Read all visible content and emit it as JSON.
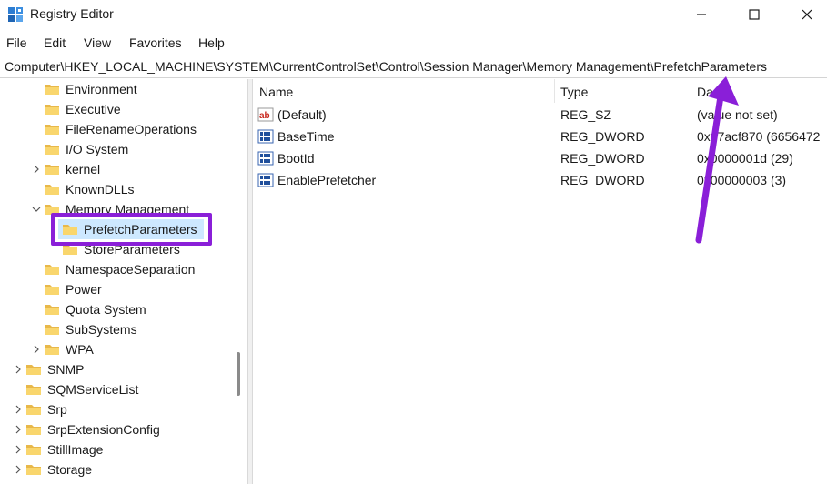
{
  "window": {
    "title": "Registry Editor",
    "controls": [
      "minimize",
      "maximize",
      "close"
    ]
  },
  "menu": {
    "items": [
      "File",
      "Edit",
      "View",
      "Favorites",
      "Help"
    ]
  },
  "address": {
    "path": "Computer\\HKEY_LOCAL_MACHINE\\SYSTEM\\CurrentControlSet\\Control\\Session Manager\\Memory Management\\PrefetchParameters"
  },
  "tree": {
    "items": [
      {
        "label": "Environment",
        "chevron": "none"
      },
      {
        "label": "Executive",
        "chevron": "none"
      },
      {
        "label": "FileRenameOperations",
        "chevron": "none"
      },
      {
        "label": "I/O System",
        "chevron": "none"
      },
      {
        "label": "kernel",
        "chevron": "collapsed"
      },
      {
        "label": "KnownDLLs",
        "chevron": "none"
      },
      {
        "label": "Memory Management",
        "chevron": "expanded"
      },
      {
        "label": "PrefetchParameters",
        "chevron": "none",
        "selected": true
      },
      {
        "label": "StoreParameters",
        "chevron": "none"
      },
      {
        "label": "NamespaceSeparation",
        "chevron": "none"
      },
      {
        "label": "Power",
        "chevron": "none"
      },
      {
        "label": "Quota System",
        "chevron": "none"
      },
      {
        "label": "SubSystems",
        "chevron": "none"
      },
      {
        "label": "WPA",
        "chevron": "collapsed"
      },
      {
        "label": "SNMP",
        "chevron": "collapsed"
      },
      {
        "label": "SQMServiceList",
        "chevron": "none"
      },
      {
        "label": "Srp",
        "chevron": "collapsed"
      },
      {
        "label": "SrpExtensionConfig",
        "chevron": "collapsed"
      },
      {
        "label": "StillImage",
        "chevron": "collapsed"
      },
      {
        "label": "Storage",
        "chevron": "collapsed"
      }
    ]
  },
  "values": {
    "headers": {
      "name": "Name",
      "type": "Type",
      "data": "Da"
    },
    "rows": [
      {
        "icon": "string-value-icon",
        "name": "(Default)",
        "type": "REG_SZ",
        "data": "(value not set)"
      },
      {
        "icon": "binary-value-icon",
        "name": "BaseTime",
        "type": "REG_DWORD",
        "data": "0x67acf870 (6656472"
      },
      {
        "icon": "binary-value-icon",
        "name": "BootId",
        "type": "REG_DWORD",
        "data": "0x0000001d (29)"
      },
      {
        "icon": "binary-value-icon",
        "name": "EnablePrefetcher",
        "type": "REG_DWORD",
        "data": "0x00000003 (3)"
      }
    ]
  },
  "annotation": {
    "highlight_color": "#8a1fd8"
  }
}
